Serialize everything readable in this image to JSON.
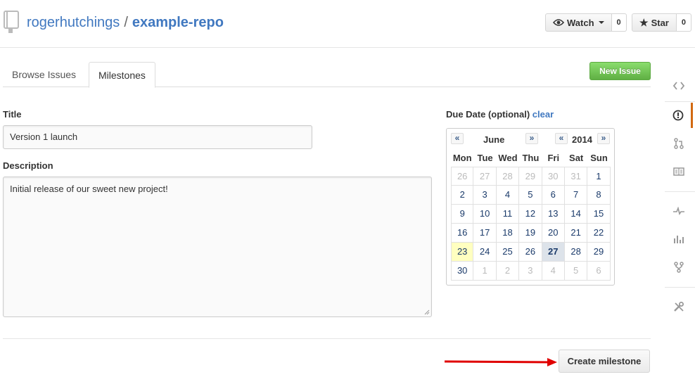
{
  "header": {
    "owner": "rogerhutchings",
    "separator": "/",
    "repo": "example-repo",
    "watch_label": "Watch",
    "watch_count": "0",
    "star_label": "Star",
    "star_count": "0"
  },
  "tabs": [
    {
      "label": "Browse Issues"
    },
    {
      "label": "Milestones"
    }
  ],
  "new_issue_label": "New Issue",
  "form": {
    "title_label": "Title",
    "title_value": "Version 1 launch",
    "description_label": "Description",
    "description_value": "Initial release of our sweet new project!",
    "due_label": "Due Date (optional)",
    "clear_label": "clear"
  },
  "calendar": {
    "prev_month": "«",
    "month": "June",
    "next_month": "»",
    "prev_year": "«",
    "year": "2014",
    "next_year": "»",
    "weekdays": [
      "Mon",
      "Tue",
      "Wed",
      "Thu",
      "Fri",
      "Sat",
      "Sun"
    ],
    "weeks": [
      [
        "26",
        "27",
        "28",
        "29",
        "30",
        "31",
        "1"
      ],
      [
        "2",
        "3",
        "4",
        "5",
        "6",
        "7",
        "8"
      ],
      [
        "9",
        "10",
        "11",
        "12",
        "13",
        "14",
        "15"
      ],
      [
        "16",
        "17",
        "18",
        "19",
        "20",
        "21",
        "22"
      ],
      [
        "23",
        "24",
        "25",
        "26",
        "27",
        "28",
        "29"
      ],
      [
        "30",
        "1",
        "2",
        "3",
        "4",
        "5",
        "6"
      ]
    ],
    "today": "23",
    "selected": "27"
  },
  "create_button_label": "Create milestone",
  "colors": {
    "link": "#4078c0",
    "primary_green": "#60b044",
    "active_sidebar": "#d26911",
    "arrow": "#e00000"
  },
  "sidebar_icons": [
    "code-icon",
    "issue-icon",
    "pull-request-icon",
    "wiki-icon",
    "pulse-icon",
    "graphs-icon",
    "network-icon",
    "settings-icon"
  ]
}
